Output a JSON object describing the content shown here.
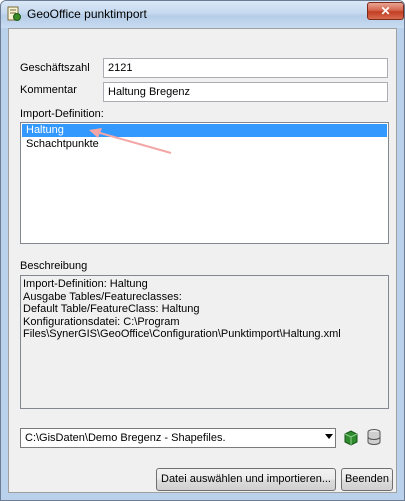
{
  "window": {
    "title": "GeoOffice punktimport",
    "close_label": "✕"
  },
  "form": {
    "geschaeftszahl_label": "Geschäftszahl",
    "geschaeftszahl_value": "2121",
    "kommentar_label": "Kommentar",
    "kommentar_value": "Haltung Bregenz",
    "import_definition_label": "Import-Definition:",
    "import_definitions": [
      "Haltung",
      "Schachtpunkte"
    ],
    "selected_index": 0
  },
  "beschreibung": {
    "label": "Beschreibung",
    "lines": [
      "Import-Definition: Haltung",
      "Ausgabe Tables/Featureclasses:",
      "Default Table/FeatureClass: Haltung",
      "Konfigurationsdatei: C:\\Program",
      "Files\\SynerGIS\\GeoOffice\\Configuration\\Punktimport\\Haltung.xml"
    ]
  },
  "datasource": {
    "selected": "C:\\GisDaten\\Demo Bregenz - Shapefiles."
  },
  "buttons": {
    "import_label": "Datei auswählen und importieren...",
    "close_label": "Beenden"
  },
  "colors": {
    "selection": "#3399ff",
    "annotation_arrow": "#f4a6a6"
  }
}
